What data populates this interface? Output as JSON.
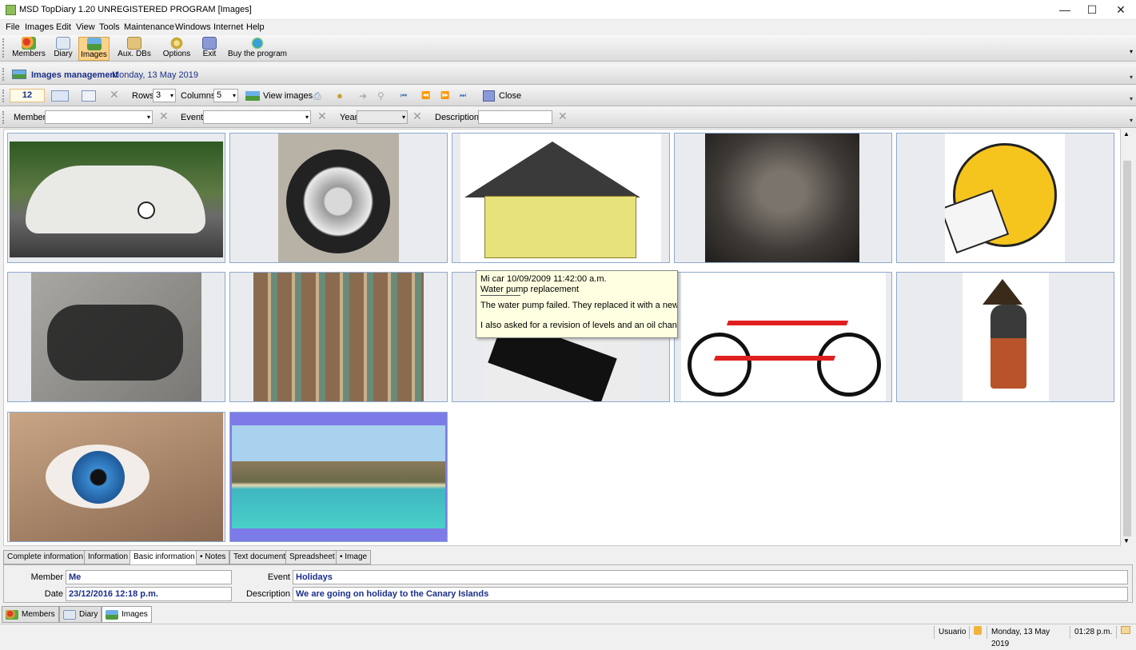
{
  "window": {
    "title": "MSD TopDiary 1.20 UNREGISTERED PROGRAM [Images]",
    "minimize": "—",
    "maximize": "☐",
    "close": "✕"
  },
  "menu": [
    "File",
    "Images",
    "Edit",
    "View",
    "Tools",
    "Maintenance",
    "Windows",
    "Internet",
    "Help"
  ],
  "toolbar": [
    {
      "label": "Members",
      "icon": "members-icon"
    },
    {
      "label": "Diary",
      "icon": "diary-icon"
    },
    {
      "label": "Images",
      "icon": "images-icon"
    },
    {
      "label": "Aux. DBs",
      "icon": "database-icon"
    },
    {
      "label": "Options",
      "icon": "gear-icon"
    },
    {
      "label": "Exit",
      "icon": "exit-icon"
    },
    {
      "label": "Buy the program",
      "icon": "buy-icon"
    }
  ],
  "panel": {
    "title": "Images management",
    "date": "Monday, 13 May 2019"
  },
  "imgbar": {
    "count": "12",
    "rows_label": "Rows",
    "rows_value": "3",
    "cols_label": "Columns",
    "cols_value": "5",
    "view_label": "View images",
    "close_label": "Close"
  },
  "filter": {
    "member_label": "Member",
    "event_label": "Event",
    "year_label": "Year",
    "desc_label": "Description"
  },
  "thumbnails": [
    {
      "subject": "white beetle car number 53",
      "bg": "#5f7a45"
    },
    {
      "subject": "car wheel close-up",
      "bg": "#b8b2a6"
    },
    {
      "subject": "yellow house drawing",
      "bg": "#e7e27a"
    },
    {
      "subject": "car engine",
      "bg": "#5a5550"
    },
    {
      "subject": "sneezing emoji",
      "bg": "#f6c51d"
    },
    {
      "subject": "motorcycle",
      "bg": "#8d8b86"
    },
    {
      "subject": "shop interior",
      "bg": "#8a6b4f"
    },
    {
      "subject": "black tablet",
      "bg": "#d9d9d9"
    },
    {
      "subject": "red bicycle",
      "bg": "#ffffff"
    },
    {
      "subject": "witch figure",
      "bg": "#ffffff"
    },
    {
      "subject": "blue eye",
      "bg": "#9a7a62"
    },
    {
      "subject": "beach landscape",
      "bg": "#3fb6c0"
    }
  ],
  "tooltip": {
    "line1": "Mi car   10/09/2009 11:42:00 a.m.",
    "line2": "Water pump replacement",
    "line3": "The water pump failed. They replaced it with a new or",
    "line4": "I also asked for a revision of levels and an oil change"
  },
  "tabs": [
    "Complete information",
    "Information",
    "Basic information",
    "• Notes",
    "Text document",
    "Spreadsheet",
    "• Image"
  ],
  "info": {
    "member_label": "Member",
    "member_value": "Me",
    "date_label": "Date",
    "date_value": "23/12/2016 12:18 p.m.",
    "event_label": "Event",
    "event_value": "Holidays",
    "desc_label": "Description",
    "desc_value": "We are going on holiday to the Canary Islands"
  },
  "window_tabs": [
    "Members",
    "Diary",
    "Images"
  ],
  "status": {
    "user": "Usuario",
    "date": "Monday, 13 May 2019",
    "time": "01:28 p.m."
  }
}
